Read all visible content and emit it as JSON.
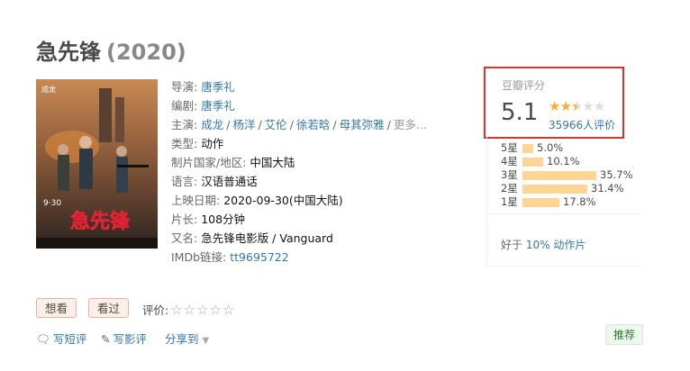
{
  "movie": {
    "title": "急先锋",
    "year": "(2020)"
  },
  "info": {
    "director_label": "导演:",
    "director": "唐季礼",
    "writer_label": "编剧:",
    "writer": "唐季礼",
    "cast_label": "主演:",
    "cast": [
      "成龙",
      "杨洋",
      "艾伦",
      "徐若晗",
      "母其弥雅"
    ],
    "cast_more": "更多...",
    "genre_label": "类型:",
    "genre": "动作",
    "country_label": "制片国家/地区:",
    "country": "中国大陆",
    "language_label": "语言:",
    "language": "汉语普通话",
    "release_label": "上映日期:",
    "release": "2020-09-30(中国大陆)",
    "runtime_label": "片长:",
    "runtime": "108分钟",
    "aka_label": "又名:",
    "aka": "急先锋电影版 / Vanguard",
    "imdb_label": "IMDb链接:",
    "imdb": "tt9695722"
  },
  "rating": {
    "label": "豆瓣评分",
    "score": "5.1",
    "stars_fraction": 0.5,
    "count": "35966人评价",
    "distribution": [
      {
        "label": "5星",
        "percent": "5.0%",
        "value": 5.0
      },
      {
        "label": "4星",
        "percent": "10.1%",
        "value": 10.1
      },
      {
        "label": "3星",
        "percent": "35.7%",
        "value": 35.7
      },
      {
        "label": "2星",
        "percent": "31.4%",
        "value": 31.4
      },
      {
        "label": "1星",
        "percent": "17.8%",
        "value": 17.8
      }
    ],
    "better_prefix": "好于",
    "better_percent": "10%",
    "better_suffix": "动作片"
  },
  "actions": {
    "want": "想看",
    "seen": "看过",
    "rate_label": "评价:",
    "short_review": "写短评",
    "review": "写影评",
    "share": "分享到",
    "recommend": "推荐"
  },
  "poster": {
    "top_names": "成龙",
    "date_text": "9·30",
    "title_text": "急先锋"
  },
  "colors": {
    "link": "#3377aa",
    "star": "#ffac2d",
    "highlight_border": "#e0312c",
    "bar": "#ffd596"
  }
}
